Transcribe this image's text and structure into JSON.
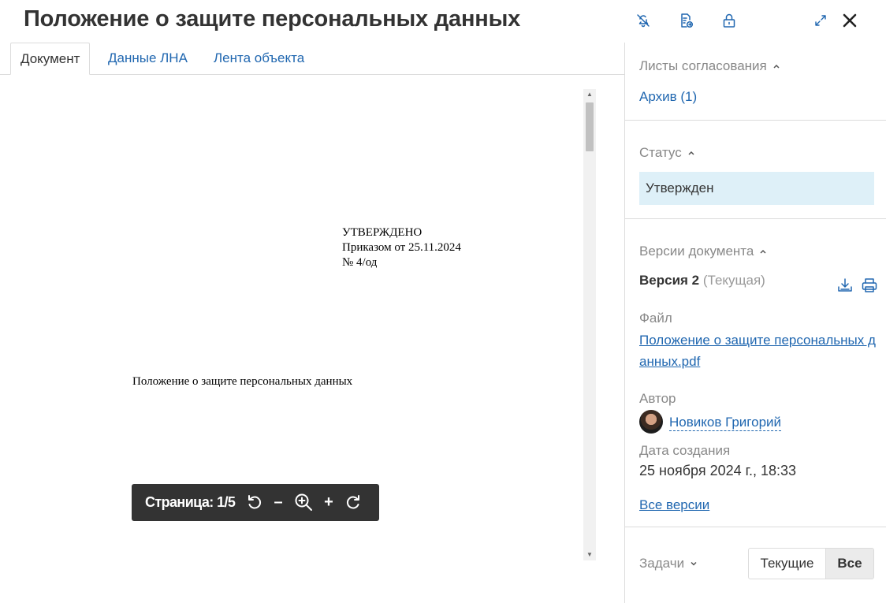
{
  "header": {
    "title": "Положение о защите персональных данных",
    "icons": {
      "mute": "bell-off-icon",
      "export": "document-export-icon",
      "lock": "lock-icon",
      "expand": "expand-icon",
      "close": "close-icon"
    }
  },
  "tabs": [
    {
      "label": "Документ"
    },
    {
      "label": "Данные ЛНА"
    },
    {
      "label": "Лента объекта"
    }
  ],
  "document": {
    "approved_lines": [
      "УТВЕРЖДЕНО",
      "Приказом от 25.11.2024",
      "№ 4/од"
    ],
    "body_title": "Положение о защите персональных данных"
  },
  "pager": {
    "label": "Страница:",
    "current": "1",
    "total": "5",
    "separator": "/",
    "minus": "–",
    "plus": "+"
  },
  "sidebar": {
    "approval_sheets": {
      "heading": "Листы согласования",
      "archive_link": "Архив (1)"
    },
    "status": {
      "heading": "Статус",
      "value": "Утвержден"
    },
    "versions": {
      "heading": "Версии документа",
      "version_name": "Версия 2",
      "version_note": "(Текущая)",
      "file_label": "Файл",
      "file_name": "Положение о защите персональных данных.pdf",
      "author_label": "Автор",
      "author_name": "Новиков Григорий",
      "created_label": "Дата создания",
      "created_value": "25 ноября 2024 г., 18:33",
      "all_versions_link": "Все версии"
    },
    "tasks": {
      "heading": "Задачи",
      "filters": [
        "Текущие",
        "Все"
      ],
      "active_filter": "Все"
    }
  },
  "colors": {
    "link": "#2067b0",
    "status_bg": "#def0f8",
    "pager_bg": "#333333",
    "active_segment_bg": "#ebebeb"
  }
}
